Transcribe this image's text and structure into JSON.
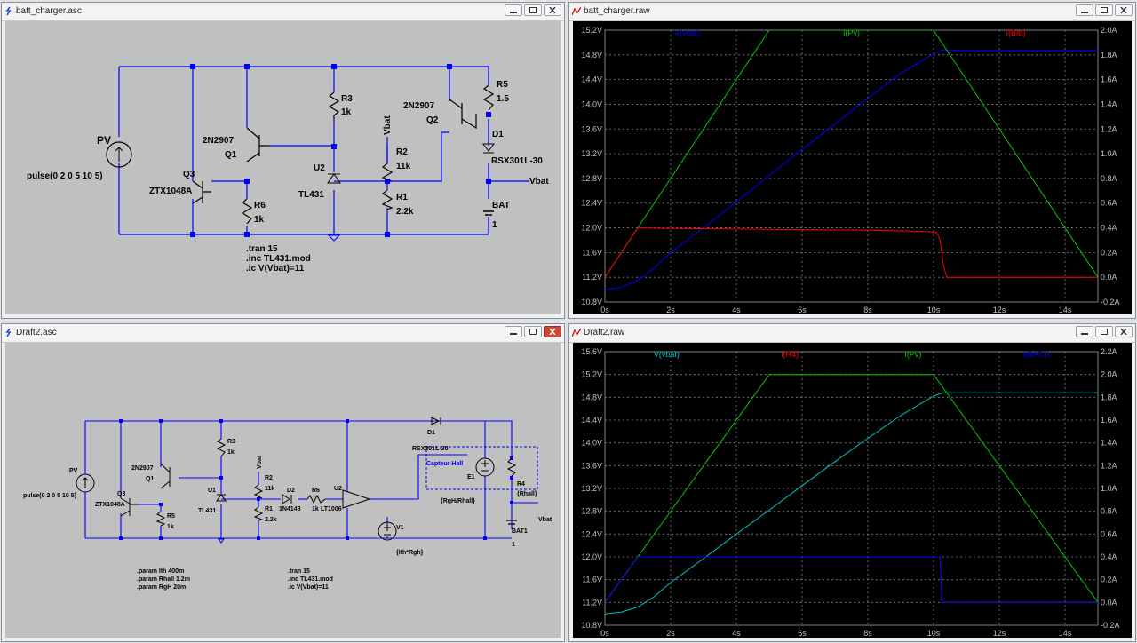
{
  "windows": {
    "schematic1": {
      "title": "batt_charger.asc"
    },
    "schematic2": {
      "title": "Draft2.asc"
    },
    "plot1": {
      "title": "batt_charger.raw"
    },
    "plot2": {
      "title": "Draft2.raw"
    }
  },
  "schematic1": {
    "labels": {
      "pv": "PV",
      "pulse": "pulse(0 2 0 5 10 5)",
      "q3": "Q3",
      "q3_model": "ZTX1048A",
      "q1": "Q1",
      "q1_model": "2N2907",
      "r6": "R6",
      "r6_val": "1k",
      "r3": "R3",
      "r3_val": "1k",
      "u2": "U2",
      "u2_model": "TL431",
      "vbat_top": "Vbat",
      "r2": "R2",
      "r2_val": "11k",
      "r1": "R1",
      "r1_val": "2.2k",
      "q2": "Q2",
      "q2_model": "2N2907",
      "r5": "R5",
      "r5_val": "1.5",
      "d1": "D1",
      "d1_model": "RSX301L-30",
      "vbat_out": "Vbat",
      "bat": "BAT",
      "bat_val": "1",
      "dir_tran": ".tran 15",
      "dir_inc": ".inc TL431.mod",
      "dir_ic": ".ic V(Vbat)=11"
    }
  },
  "schematic2": {
    "labels": {
      "pv": "PV",
      "pulse": "pulse(0 2 0 5 10 5)",
      "q3": "Q3",
      "q3_model": "ZTX1048A",
      "q1": "Q1",
      "q1_model": "2N2907",
      "r5": "R5",
      "r5_val": "1k",
      "r3": "R3",
      "r3_val": "1k",
      "u1": "U1",
      "u1_model": "TL431",
      "vbat_top": "Vbat",
      "r2": "R2",
      "r2_val": "11k",
      "r1": "R1",
      "r1_val": "2.2k",
      "d2": "D2",
      "d2_model": "1N4148",
      "r6": "R6",
      "r6_val": "1k",
      "u2": "U2",
      "u2_model": "LT1006",
      "v1": "V1",
      "v1_val": "{Ith*Rgh}",
      "d1": "D1",
      "d1_model": "RSX301L-30",
      "hall": "Capteur Hall",
      "e1": "E1",
      "e1_val": "{RgH/Rhall}",
      "r4": "R4",
      "r4_val": "{Rhall}",
      "vbat_out": "Vbat",
      "bat1": "BAT1",
      "bat1_val": "1",
      "param_ith": ".param Ith 400m",
      "param_rhall": ".param Rhall 1.2m",
      "param_rgh": ".param RgH 20m",
      "dir_tran": ".tran 15",
      "dir_inc": ".inc TL431.mod",
      "dir_ic": ".ic V(Vbat)=11"
    }
  },
  "chart_data": [
    {
      "type": "line",
      "title": "batt_charger.raw",
      "x_ticks": [
        "0s",
        "2s",
        "4s",
        "6s",
        "8s",
        "10s",
        "12s",
        "14s"
      ],
      "xlim": [
        0,
        15
      ],
      "y_left_ticks": [
        "15.2V",
        "14.8V",
        "14.4V",
        "14.0V",
        "13.6V",
        "13.2V",
        "12.8V",
        "12.4V",
        "12.0V",
        "11.6V",
        "11.2V",
        "10.8V"
      ],
      "ylim_left": [
        10.8,
        15.2
      ],
      "y_right_ticks": [
        "2.0A",
        "1.8A",
        "1.6A",
        "1.4A",
        "1.2A",
        "1.0A",
        "0.8A",
        "0.6A",
        "0.4A",
        "0.2A",
        "0.0A",
        "-0.2A"
      ],
      "ylim_right": [
        -0.2,
        2.0
      ],
      "grid": true,
      "series": [
        {
          "name": "V(vbat)",
          "color": "#0000ff",
          "axis": "left",
          "x": [
            0,
            0.5,
            1,
            1.5,
            2,
            3,
            4,
            5,
            6,
            7,
            8,
            9,
            10,
            10.3,
            11,
            12,
            13,
            14,
            15
          ],
          "y": [
            11.0,
            11.04,
            11.15,
            11.35,
            11.6,
            12.0,
            12.42,
            12.85,
            13.27,
            13.68,
            14.1,
            14.5,
            14.82,
            14.88,
            14.87,
            14.87,
            14.87,
            14.87,
            14.87
          ]
        },
        {
          "name": "I(Pv)",
          "color": "#00cc00",
          "axis": "right",
          "x": [
            0,
            5,
            10,
            15
          ],
          "y": [
            0.0,
            2.0,
            2.0,
            0.0
          ]
        },
        {
          "name": "I(Bat)",
          "color": "#ff0000",
          "axis": "right",
          "x": [
            0,
            1,
            2,
            4,
            6,
            8,
            9,
            9.8,
            10.1,
            10.2,
            10.3,
            10.4,
            12,
            15
          ],
          "y": [
            0.0,
            0.4,
            0.395,
            0.39,
            0.385,
            0.38,
            0.375,
            0.37,
            0.36,
            0.3,
            0.1,
            0.0,
            0.0,
            0.0
          ]
        }
      ]
    },
    {
      "type": "line",
      "title": "Draft2.raw",
      "x_ticks": [
        "0s",
        "2s",
        "4s",
        "6s",
        "8s",
        "10s",
        "12s",
        "14s"
      ],
      "xlim": [
        0,
        15
      ],
      "y_left_ticks": [
        "15.6V",
        "15.2V",
        "14.8V",
        "14.4V",
        "14.0V",
        "13.6V",
        "13.2V",
        "12.8V",
        "12.4V",
        "12.0V",
        "11.6V",
        "11.2V",
        "10.8V"
      ],
      "ylim_left": [
        10.8,
        15.6
      ],
      "y_right_ticks": [
        "2.2A",
        "2.0A",
        "1.8A",
        "1.6A",
        "1.4A",
        "1.2A",
        "1.0A",
        "0.8A",
        "0.6A",
        "0.4A",
        "0.2A",
        "0.0A",
        "-0.2A"
      ],
      "ylim_right": [
        -0.2,
        2.2
      ],
      "grid": true,
      "series": [
        {
          "name": "V(vbat)",
          "color": "#00c0c0",
          "axis": "left",
          "x": [
            0,
            0.5,
            1,
            1.5,
            2,
            3,
            4,
            5,
            6,
            7,
            8,
            9,
            10,
            10.3,
            11,
            12,
            13,
            14,
            15
          ],
          "y": [
            11.0,
            11.03,
            11.12,
            11.3,
            11.55,
            11.97,
            12.4,
            12.82,
            13.25,
            13.67,
            14.08,
            14.48,
            14.82,
            14.88,
            14.88,
            14.88,
            14.88,
            14.88,
            14.88
          ]
        },
        {
          "name": "I(R4)",
          "color": "#ff0000",
          "axis": "right",
          "x": [
            0,
            1,
            10.2,
            10.25,
            15
          ],
          "y": [
            0.0,
            0.4,
            0.4,
            0.0,
            0.0
          ]
        },
        {
          "name": "I(Pv)",
          "color": "#00cc00",
          "axis": "right",
          "x": [
            0,
            5,
            10,
            15
          ],
          "y": [
            0.0,
            2.0,
            2.0,
            0.0
          ]
        },
        {
          "name": "I(BAT1)",
          "color": "#0000ff",
          "axis": "right",
          "x": [
            0,
            1,
            10.2,
            10.25,
            15
          ],
          "y": [
            0.0,
            0.4,
            0.4,
            0.0,
            0.0
          ]
        }
      ]
    }
  ]
}
